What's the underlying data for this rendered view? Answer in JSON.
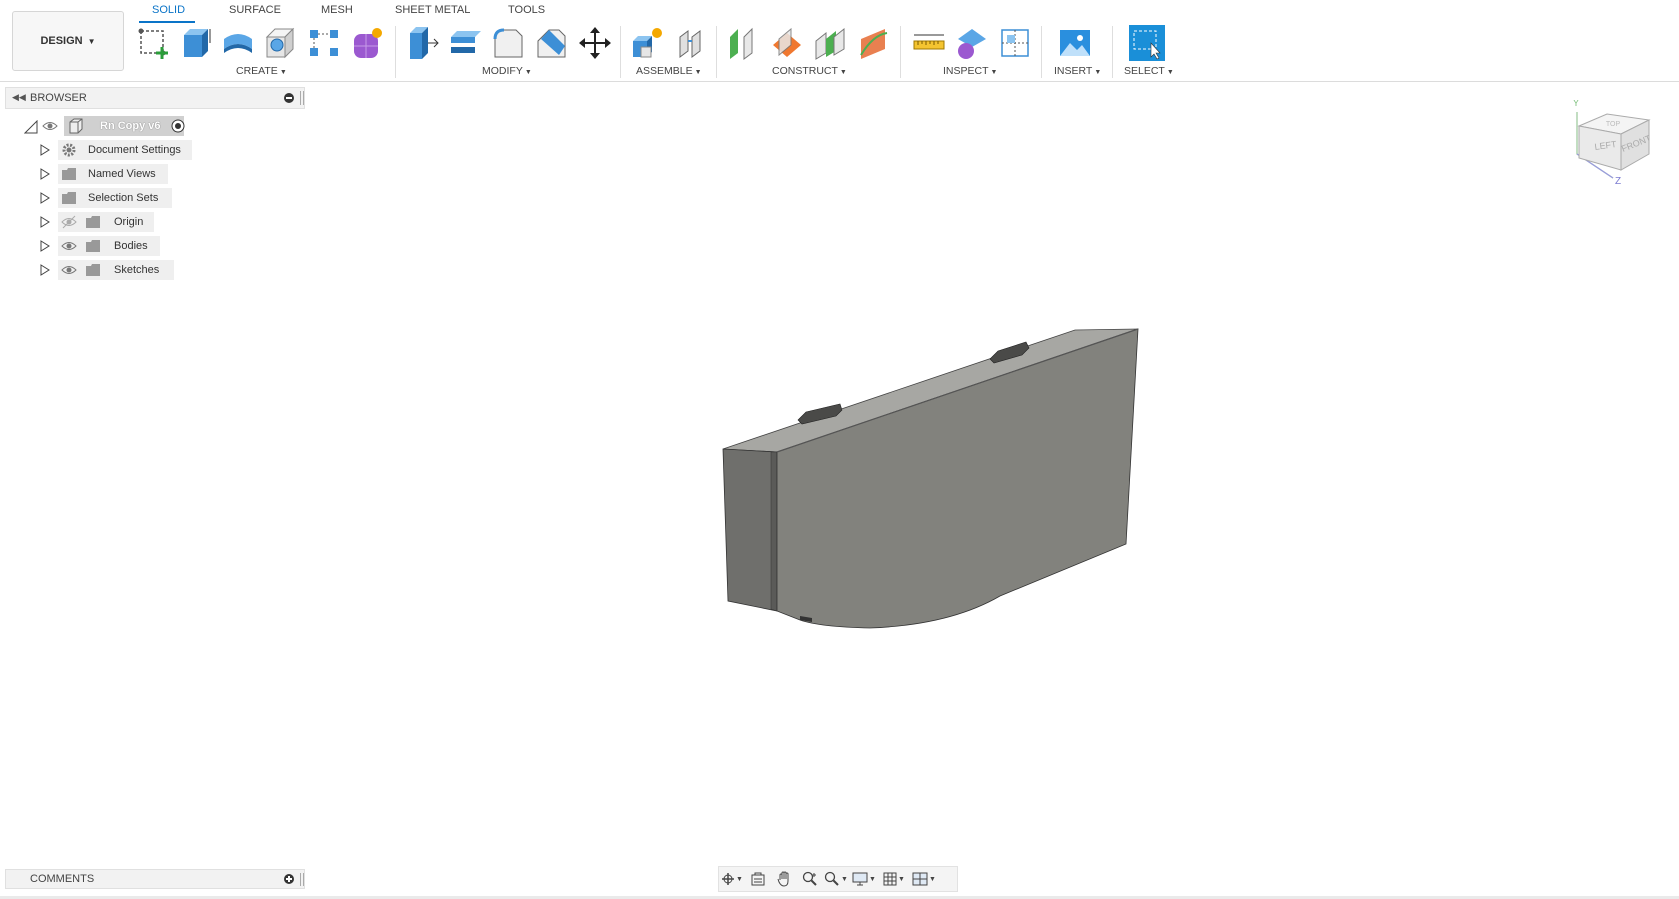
{
  "workspace": {
    "label": "DESIGN"
  },
  "tabs": [
    {
      "label": "SOLID",
      "active": true
    },
    {
      "label": "SURFACE",
      "active": false
    },
    {
      "label": "MESH",
      "active": false
    },
    {
      "label": "SHEET METAL",
      "active": false
    },
    {
      "label": "TOOLS",
      "active": false
    }
  ],
  "groups": {
    "create": {
      "label": "CREATE",
      "tools": [
        "create-sketch-icon",
        "extrude-icon",
        "revolve-icon",
        "hole-icon",
        "rectangular-pattern-icon",
        "create-form-icon"
      ]
    },
    "modify": {
      "label": "MODIFY",
      "tools": [
        "press-pull-icon",
        "shell-icon",
        "fillet-icon",
        "chamfer-icon",
        "move-copy-icon"
      ]
    },
    "assemble": {
      "label": "ASSEMBLE",
      "tools": [
        "new-component-icon",
        "joint-icon"
      ]
    },
    "construct": {
      "label": "CONSTRUCT",
      "tools": [
        "offset-plane-icon",
        "plane-at-angle-icon",
        "midplane-icon",
        "plane-along-path-icon"
      ]
    },
    "inspect": {
      "label": "INSPECT",
      "tools": [
        "measure-icon",
        "interference-icon",
        "section-analysis-icon"
      ]
    },
    "insert": {
      "label": "INSERT",
      "tools": [
        "insert-image-icon"
      ]
    },
    "select": {
      "label": "SELECT",
      "tools": [
        "window-select-icon"
      ]
    }
  },
  "browser": {
    "title": "BROWSER",
    "root": {
      "label": "Rn Copy v6"
    },
    "items": [
      {
        "label": "Document Settings",
        "icon": "gear-icon"
      },
      {
        "label": "Named Views",
        "icon": "folder-icon"
      },
      {
        "label": "Selection Sets",
        "icon": "folder-icon"
      },
      {
        "label": "Origin",
        "icon": "folder-icon",
        "visibility": "hidden"
      },
      {
        "label": "Bodies",
        "icon": "folder-icon",
        "visibility": "visible"
      },
      {
        "label": "Sketches",
        "icon": "folder-icon",
        "visibility": "visible"
      }
    ]
  },
  "viewcube": {
    "left": "LEFT",
    "front": "FRONT",
    "top": "TOP",
    "axis_y": "Y",
    "axis_z": "Z"
  },
  "comments": {
    "title": "COMMENTS"
  },
  "navbar": [
    "orbit-icon",
    "look-at-icon",
    "pan-icon",
    "zoom-icon",
    "fit-icon",
    "display-settings-icon",
    "grid-settings-icon",
    "viewports-icon"
  ],
  "colors": {
    "accent": "#0a74c8",
    "body": "#8c8c86",
    "select_tool": "#1a8fd8"
  }
}
